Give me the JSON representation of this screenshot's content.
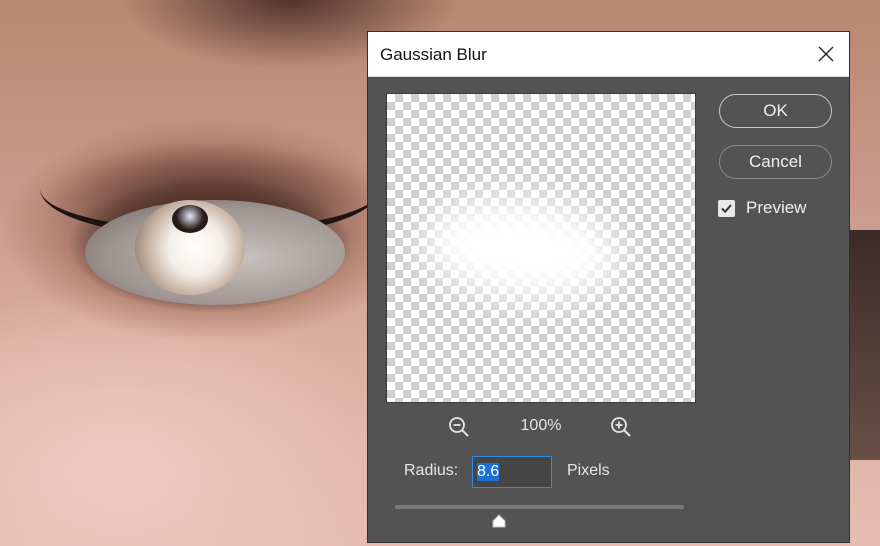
{
  "dialog": {
    "title": "Gaussian Blur",
    "ok_label": "OK",
    "cancel_label": "Cancel",
    "preview_label": "Preview",
    "preview_checked": true
  },
  "preview": {
    "zoom_level": "100%"
  },
  "radius": {
    "label": "Radius:",
    "value": "8.6",
    "units": "Pixels",
    "slider_fraction": 0.36
  },
  "icons": [
    "close-icon",
    "zoom-out-icon",
    "zoom-in-icon",
    "checkmark-icon",
    "slider-thumb-icon"
  ],
  "colors": {
    "dialog_bg": "#535353",
    "accent": "#2b8be8",
    "titlebar_bg": "#ffffff"
  }
}
